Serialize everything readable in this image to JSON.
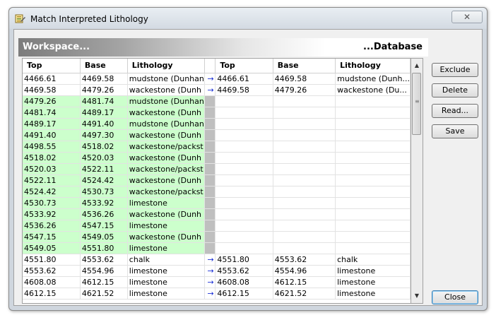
{
  "window": {
    "title": "Match Interpreted Lithology",
    "close_glyph": "✕"
  },
  "banner": {
    "left_label": "Workspace...",
    "right_label": "...Database"
  },
  "grid": {
    "columns": [
      "Top",
      "Base",
      "Lithology",
      "Top",
      "Base",
      "Lithology"
    ],
    "rows": [
      {
        "wt": "4466.61",
        "wb": "4469.58",
        "wl": "mudstone (Dunhan",
        "dt": "4466.61",
        "db": "4469.58",
        "dl": "mudstone (Dunh...",
        "matched": true
      },
      {
        "wt": "4469.58",
        "wb": "4479.26",
        "wl": "wackestone (Dunh",
        "dt": "4469.58",
        "db": "4479.26",
        "dl": "wackestone (Du...",
        "matched": true
      },
      {
        "wt": "4479.26",
        "wb": "4481.74",
        "wl": "mudstone (Dunhan",
        "dt": "",
        "db": "",
        "dl": "",
        "matched": false
      },
      {
        "wt": "4481.74",
        "wb": "4489.17",
        "wl": "wackestone (Dunh",
        "dt": "",
        "db": "",
        "dl": "",
        "matched": false
      },
      {
        "wt": "4489.17",
        "wb": "4491.40",
        "wl": "mudstone (Dunhan",
        "dt": "",
        "db": "",
        "dl": "",
        "matched": false
      },
      {
        "wt": "4491.40",
        "wb": "4497.30",
        "wl": "wackestone (Dunh",
        "dt": "",
        "db": "",
        "dl": "",
        "matched": false
      },
      {
        "wt": "4498.55",
        "wb": "4518.02",
        "wl": "wackestone/packst",
        "dt": "",
        "db": "",
        "dl": "",
        "matched": false
      },
      {
        "wt": "4518.02",
        "wb": "4520.03",
        "wl": "wackestone (Dunh",
        "dt": "",
        "db": "",
        "dl": "",
        "matched": false
      },
      {
        "wt": "4520.03",
        "wb": "4522.11",
        "wl": "wackestone/packst",
        "dt": "",
        "db": "",
        "dl": "",
        "matched": false
      },
      {
        "wt": "4522.11",
        "wb": "4524.42",
        "wl": "wackestone (Dunh",
        "dt": "",
        "db": "",
        "dl": "",
        "matched": false
      },
      {
        "wt": "4524.42",
        "wb": "4530.73",
        "wl": "wackestone/packst",
        "dt": "",
        "db": "",
        "dl": "",
        "matched": false
      },
      {
        "wt": "4530.73",
        "wb": "4533.92",
        "wl": "limestone",
        "dt": "",
        "db": "",
        "dl": "",
        "matched": false
      },
      {
        "wt": "4533.92",
        "wb": "4536.26",
        "wl": "wackestone (Dunh",
        "dt": "",
        "db": "",
        "dl": "",
        "matched": false
      },
      {
        "wt": "4536.26",
        "wb": "4547.15",
        "wl": "limestone",
        "dt": "",
        "db": "",
        "dl": "",
        "matched": false
      },
      {
        "wt": "4547.15",
        "wb": "4549.05",
        "wl": "wackestone (Dunh",
        "dt": "",
        "db": "",
        "dl": "",
        "matched": false
      },
      {
        "wt": "4549.05",
        "wb": "4551.80",
        "wl": "limestone",
        "dt": "",
        "db": "",
        "dl": "",
        "matched": false
      },
      {
        "wt": "4551.80",
        "wb": "4553.62",
        "wl": "chalk",
        "dt": "4551.80",
        "db": "4553.62",
        "dl": "chalk",
        "matched": true
      },
      {
        "wt": "4553.62",
        "wb": "4554.96",
        "wl": "limestone",
        "dt": "4553.62",
        "db": "4554.96",
        "dl": "limestone",
        "matched": true
      },
      {
        "wt": "4608.08",
        "wb": "4612.15",
        "wl": "limestone",
        "dt": "4608.08",
        "db": "4612.15",
        "dl": "limestone",
        "matched": true
      },
      {
        "wt": "4612.15",
        "wb": "4621.52",
        "wl": "limestone",
        "dt": "4612.15",
        "db": "4621.52",
        "dl": "limestone",
        "matched": true
      }
    ],
    "arrow_glyph": "→",
    "unmatched_color": "#ccffcc",
    "gap_color": "#bfbfbf",
    "arrow_color": "#1a2fd6"
  },
  "scrollbar": {
    "up_glyph": "▲",
    "down_glyph": "▼",
    "grip_glyph": "≡"
  },
  "buttons": {
    "exclude": "Exclude",
    "delete": "Delete",
    "read": "Read...",
    "save": "Save",
    "close": "Close"
  }
}
